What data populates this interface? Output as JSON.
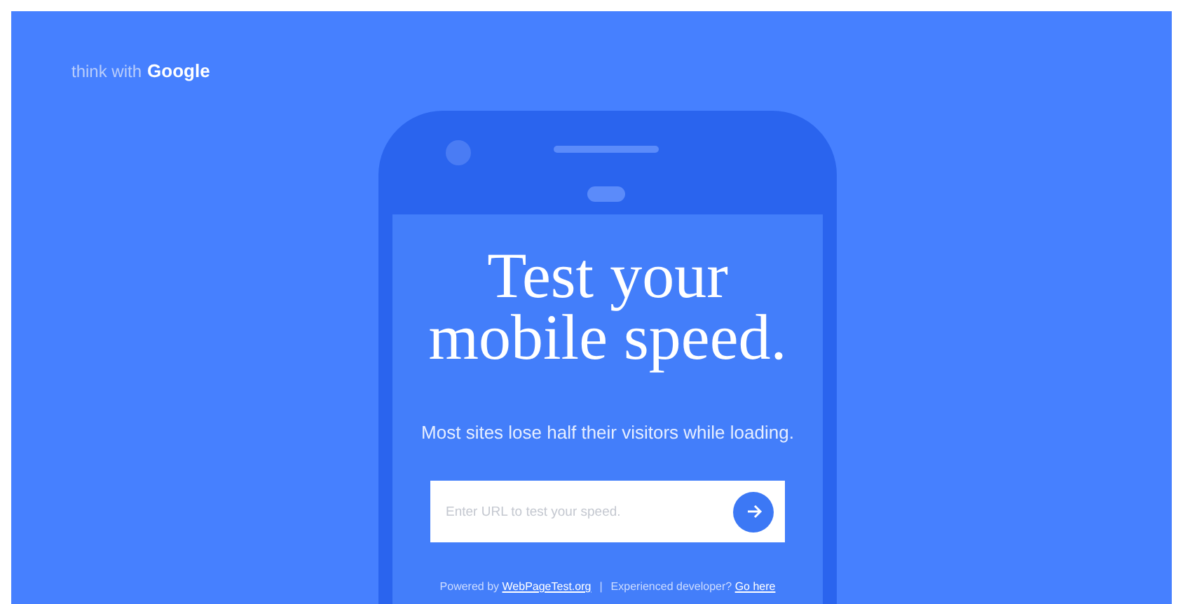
{
  "logo": {
    "prefix": "think with",
    "brand": "Google"
  },
  "hero": {
    "title_lines": [
      "Test your",
      "mobile speed."
    ],
    "subtitle": "Most sites lose half their visitors while loading."
  },
  "url_form": {
    "placeholder": "Enter URL to test your speed."
  },
  "footer": {
    "powered_by_label": "Powered by",
    "powered_by_link": "WebPageTest.org",
    "separator": "|",
    "developer_label": "Experienced developer?",
    "developer_link": "Go here"
  }
}
